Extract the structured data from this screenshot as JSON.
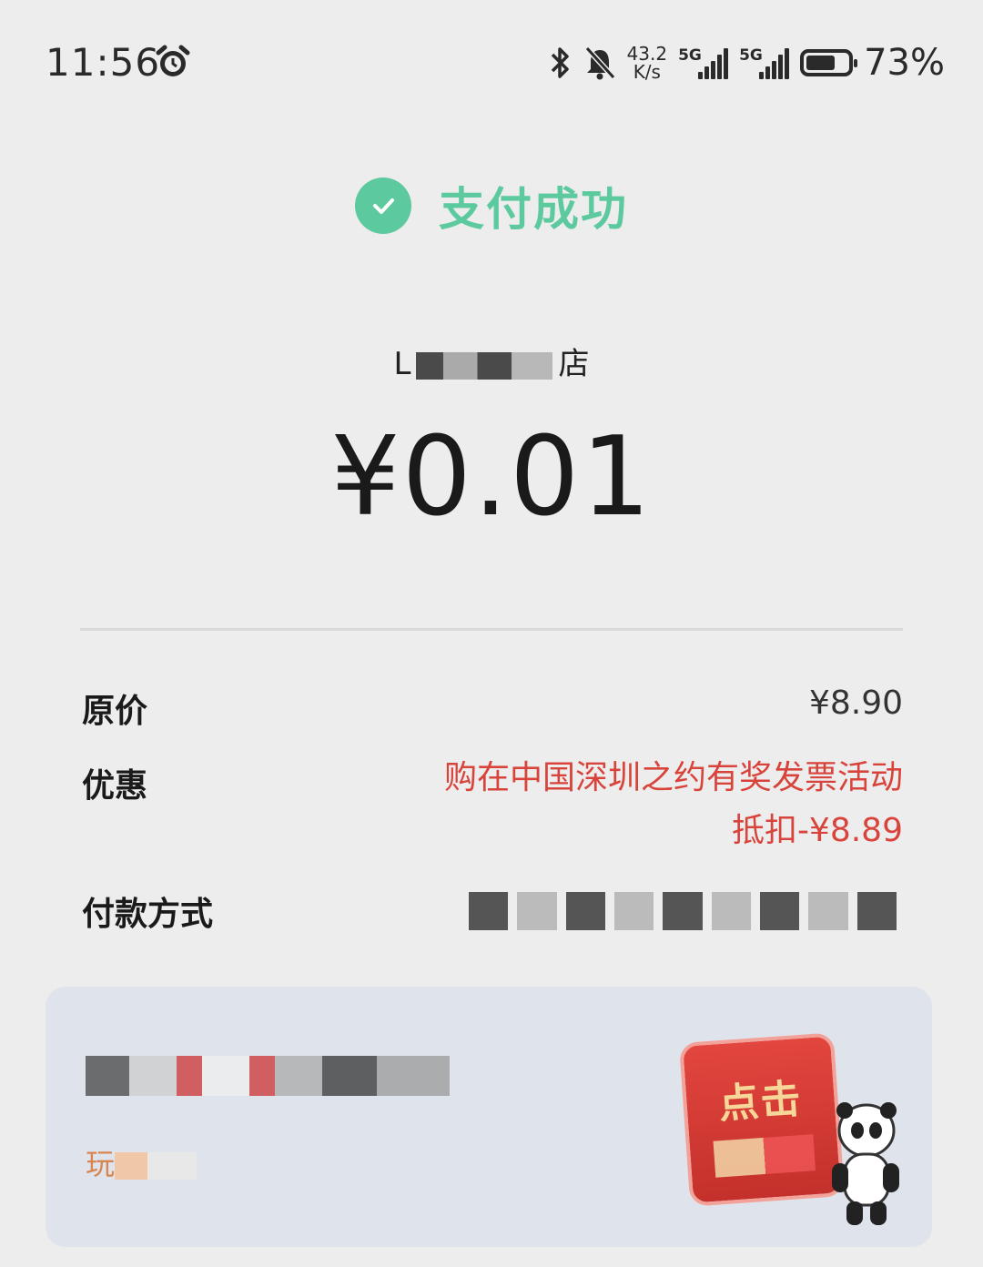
{
  "status_bar": {
    "time": "11:56",
    "net_speed_value": "43.2",
    "net_speed_unit": "K/s",
    "sim1_tag": "5G",
    "sim2_tag": "5G",
    "battery_percent": "73%",
    "battery_level": 0.73,
    "icons": [
      "alarm-icon",
      "bluetooth-icon",
      "bell-mute-icon",
      "signal-icon",
      "battery-icon"
    ]
  },
  "header": {
    "title": "支付成功",
    "accent_color": "#5dc99f"
  },
  "merchant": {
    "prefix": "L",
    "suffix": "店"
  },
  "payment": {
    "amount": "¥0.01"
  },
  "details": {
    "original_price_label": "原价",
    "original_price_value": "¥8.90",
    "discount_label": "优惠",
    "discount_line1": "购在中国深圳之约有奖发票活动",
    "discount_line2": "抵扣-¥8.89",
    "discount_color": "#d8443c",
    "payment_method_label": "付款方式"
  },
  "promo": {
    "button_text": "点击",
    "subtitle_prefix": "玩"
  }
}
